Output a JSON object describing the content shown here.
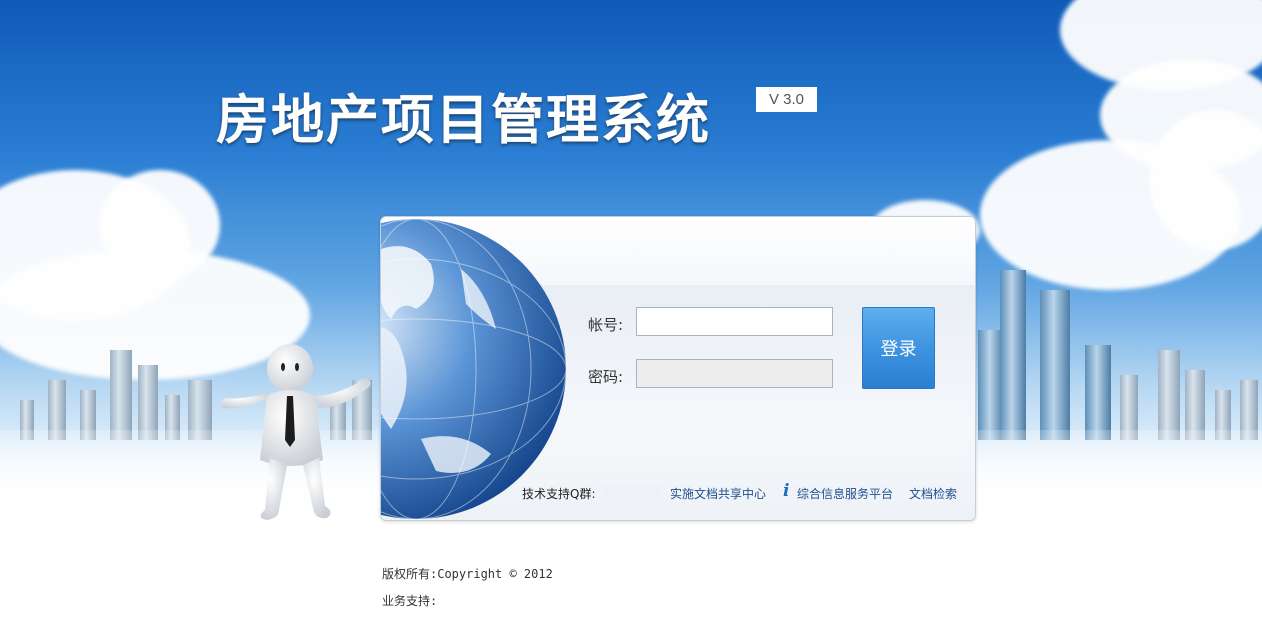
{
  "header": {
    "title": "房地产项目管理系统",
    "version": "V 3.0"
  },
  "login": {
    "account_label": "帐号:",
    "account_value": "",
    "password_label": "密码:",
    "password_value": "",
    "submit_label": "登录"
  },
  "panel_footer": {
    "support_label": "技术支持Q群:",
    "links": [
      "实施文档共享中心",
      "综合信息服务平台",
      "文档检索"
    ]
  },
  "footer": {
    "copyright": "版权所有:Copyright © 2012",
    "business_support": "业务支持:"
  },
  "colors": {
    "sky_top": "#0f5bb8",
    "button": "#3f94e0",
    "link": "#1e4f8f"
  },
  "icons": [
    "globe-image",
    "mascot-image",
    "info-icon"
  ]
}
